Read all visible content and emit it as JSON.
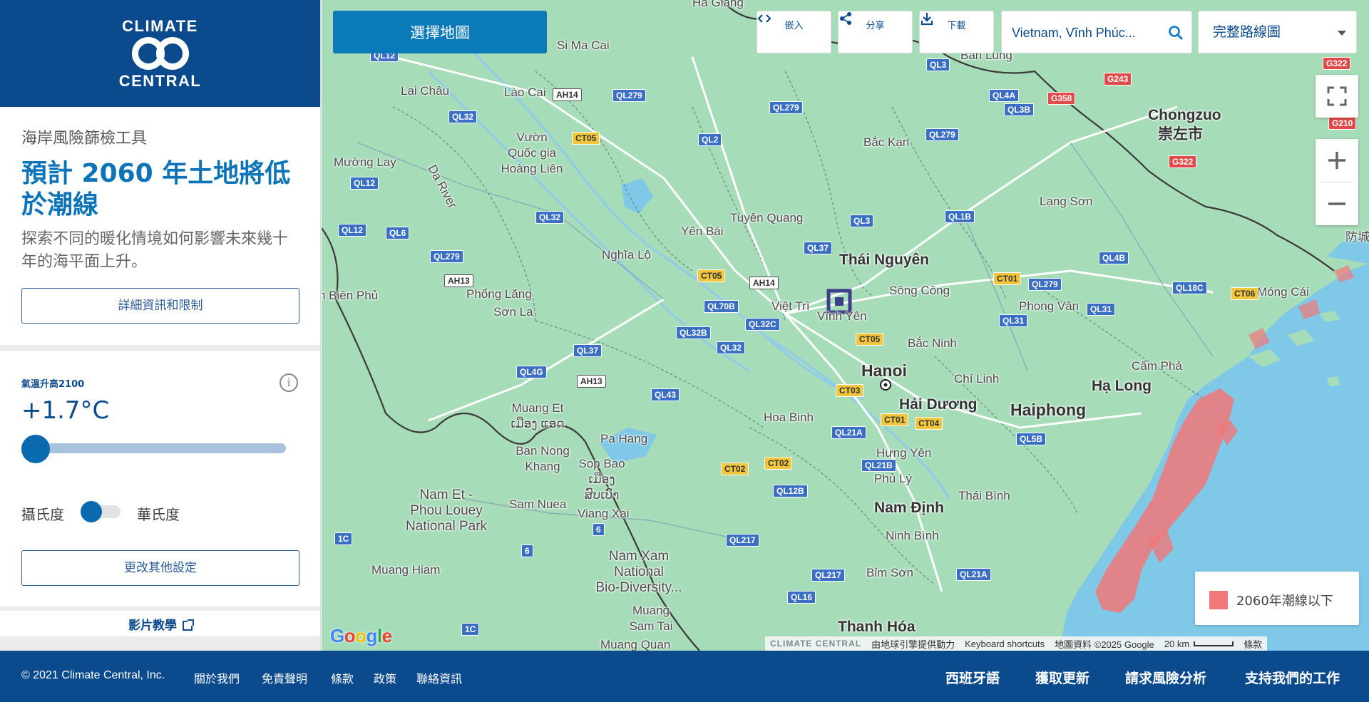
{
  "brand": {
    "line1": "CLIMATE",
    "line2": "CENTRAL"
  },
  "intro": {
    "tool_name": "海岸風險篩檢工具",
    "headline": "預計 2060 年土地將低於潮線",
    "subtext": "探索不同的暖化情境如何影響未來幾十年的海平面上升。",
    "details_button": "詳細資訊和限制"
  },
  "controls": {
    "temp_label": "氣溫升高2100",
    "temp_value": "+1.7°C",
    "slider_fraction": 0.0,
    "unit_celsius": "攝氏度",
    "unit_fahrenheit": "華氏度",
    "settings_button": "更改其他設定",
    "info_icon": "i"
  },
  "video_link": "影片教學",
  "map": {
    "select_map_button": "選擇地圖",
    "tools": [
      {
        "icon": "<>",
        "label": "嵌入",
        "icon_name": "code-icon"
      },
      {
        "icon": "share",
        "label": "分享",
        "icon_name": "share-icon"
      },
      {
        "icon": "download",
        "label": "下載",
        "icon_name": "download-icon"
      }
    ],
    "search_value": "Vietnam, Vĩnh Phúc...",
    "map_type": "完整路線圖",
    "legend_label": "2060年潮線以下",
    "legend_color": "#f17878",
    "places": {
      "ha_giang": "Ha Giang",
      "si_ma_cai": "Si Ma Cai",
      "ban_lung": "Ban Lung",
      "lai_chau": "Lai Châu",
      "lao_cai": "Lào Cai",
      "vuon_quoc_gia": "Vườn\nQuốc gia\nHoàng Liên",
      "muong_lay": "Mường Lay",
      "da_river": "Da River",
      "bac_kan": "Bắc Kạn",
      "chongzuo": "Chongzuo",
      "chongzuo_cn": "崇左市",
      "lang_son": "Lạng Sơn",
      "fangcheng": "防城",
      "yen_bai": "Yên Bái",
      "tuyen_quang": "Tuyên Quang",
      "thai_nguyen": "Thái Nguyên",
      "song_cong": "Sông Công",
      "nghia_lo": "Nghĩa Lộ",
      "dien_bien_phu": "n Biên Phủ",
      "phong_lang": "Phổng Lăng",
      "son_la": "Sơn La",
      "viet_tri": "Việt Trì",
      "vinh_yen": "Vĩnh Yên",
      "phong_van": "Phong Vân",
      "mong_cai": "Móng Cái",
      "bac_ninh": "Bắc Ninh",
      "hanoi": "Hanoi",
      "chi_linh": "Chí Linh",
      "cam_pha": "Cẩm Phả",
      "ha_long": "Hạ Long",
      "hai_duong": "Hải Dương",
      "haiphong": "Haiphong",
      "hoa_binh": "Hoa Binh",
      "muang_et": "Muang Et\nເມືອງ ແອດ",
      "pa_hang": "Pa Hang",
      "ban_nong_khang": "Ban Nong\nKhang",
      "sop_bao": "Sop Bao\nເມືອງ\nສົບເບົາ",
      "hung_yen": "Hưng Yên",
      "phu_ly": "Phủ Lý",
      "thai_binh": "Thái Bình",
      "nam_et": "Nam Et -\nPhou Louey\nNational Park",
      "sam_nuea": "Sam Nuea",
      "viang_xai": "Viang Xai",
      "nam_dinh": "Nam Định",
      "ninh_binh": "Ninh Bình",
      "nam_xam": "Nam Xam\nNational\nBio-Diversity...",
      "muang_hiam": "Muang Hiam",
      "bim_son": "Bỉm Sơn",
      "muang_sam_tai": "Muang\nSam Tai",
      "thanh_hoa": "Thanh Hóa",
      "muang_quan": "Muang Quan"
    },
    "shields": {
      "ql12a": "QL12",
      "ql12b": "QL12",
      "ql12c": "QL12",
      "ql279a": "QL279",
      "ql279b": "QL279",
      "ql279c": "QL279",
      "ql279d": "QL279",
      "ql279e": "QL279",
      "ql32a": "QL32",
      "ql32b": "QL32",
      "ql32c": "QL32",
      "ql6": "QL6",
      "ql2": "QL2",
      "ql3a": "QL3",
      "ql3b": "QL3",
      "ql4a": "QL4A",
      "ql3b2": "QL3B",
      "ql1b": "QL1B",
      "ql37a": "QL37",
      "ql37b": "QL37",
      "ql4b": "QL4B",
      "ql18c": "QL18C",
      "ql31a": "QL31",
      "ql31b": "QL31",
      "ql70b": "QL70B",
      "ql32c2": "QL32C",
      "ql32b2": "QL32B",
      "ql4g": "QL4G",
      "ql43": "QL43",
      "ql21a": "QL21A",
      "ql21b": "QL21B",
      "ql5b": "QL5B",
      "ql12b2": "QL12B",
      "ql217a": "QL217",
      "ql217b": "QL217",
      "ql16": "QL16",
      "ql21a2": "QL21A",
      "ct05a": "CT05",
      "ct05b": "CT05",
      "ct05c": "CT05",
      "ct01a": "CT01",
      "ct01b": "CT01",
      "ct03": "CT03",
      "ct04": "CT04",
      "ct02a": "CT02",
      "ct02b": "CT02",
      "ct06": "CT06",
      "ah14a": "AH14",
      "ah14b": "AH14",
      "ah13a": "AH13",
      "ah13b": "AH13",
      "g322a": "G322",
      "g322b": "G322",
      "g243": "G243",
      "g358": "G358",
      "g210": "G210",
      "r1c": "1C",
      "r1c2": "1C",
      "r6a": "6",
      "r6b": "6"
    },
    "attribution": {
      "cc": "CLIMATE CENTRAL",
      "earth_engine": "由地球引擎提供動力",
      "keyboard": "Keyboard shortcuts",
      "map_data": "地圖資料 ©2025 Google",
      "scale": "20 km",
      "terms": "條款"
    },
    "google_logo": [
      "G",
      "o",
      "o",
      "g",
      "l",
      "e"
    ]
  },
  "footer": {
    "copyright": "© 2021 Climate Central, Inc.",
    "links": [
      "關於我們",
      "免責聲明",
      "條款",
      "政策",
      "聯絡資訊"
    ],
    "right_links": [
      "西班牙語",
      "獲取更新",
      "請求風險分析",
      "支持我們的工作"
    ]
  }
}
